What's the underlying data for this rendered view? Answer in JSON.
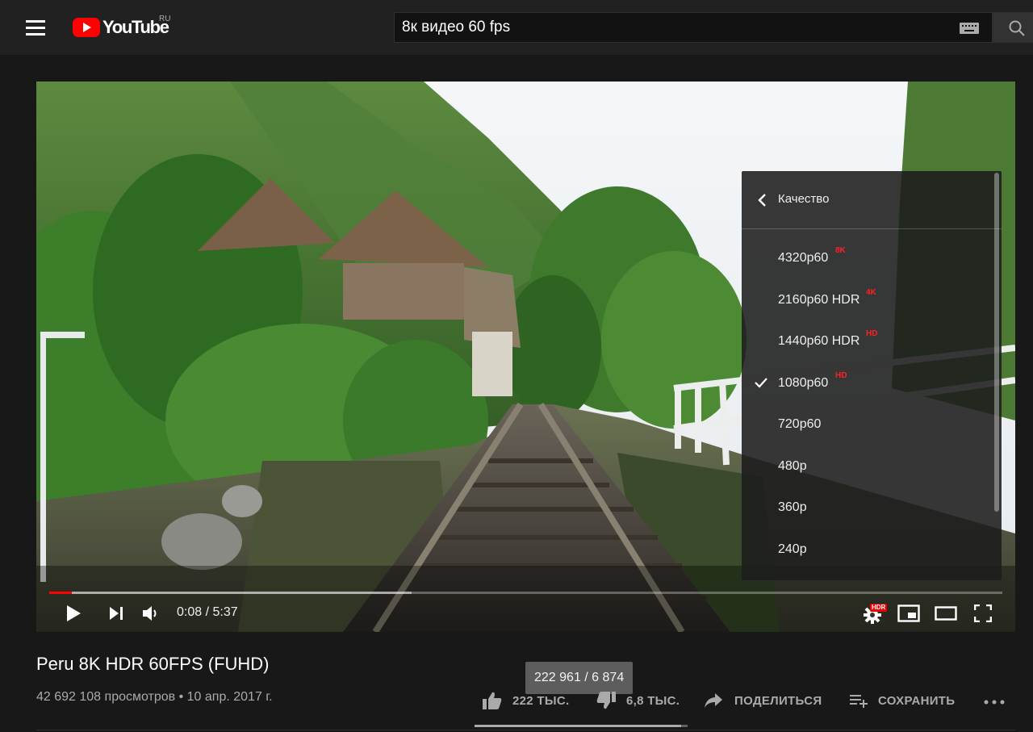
{
  "header": {
    "logo_text": "YouTube",
    "country_code": "RU",
    "search_query": "8к видео 60 fps"
  },
  "player": {
    "current_time": "0:08",
    "duration": "5:37",
    "time_display": "0:08 / 5:37",
    "progress_fraction": 0.024,
    "buffer_fraction": 0.38,
    "hdr_badge": "HDR",
    "quality_menu": {
      "title": "Качество",
      "options": [
        {
          "label": "4320p60",
          "badge": "8K",
          "selected": false
        },
        {
          "label": "2160p60 HDR",
          "badge": "4K",
          "selected": false
        },
        {
          "label": "1440p60 HDR",
          "badge": "HD",
          "selected": false
        },
        {
          "label": "1080p60",
          "badge": "HD",
          "selected": true
        },
        {
          "label": "720p60",
          "badge": "",
          "selected": false
        },
        {
          "label": "480p",
          "badge": "",
          "selected": false
        },
        {
          "label": "360p",
          "badge": "",
          "selected": false
        },
        {
          "label": "240p",
          "badge": "",
          "selected": false
        }
      ]
    }
  },
  "video": {
    "title": "Peru 8K HDR 60FPS (FUHD)",
    "meta": "42 692 108 просмотров • 10 апр. 2017 г.",
    "tooltip": "222 961 / 6 874",
    "like_ratio": 0.97,
    "actions": {
      "like": "222 ТЫС.",
      "dislike": "6,8 ТЫС.",
      "share": "ПОДЕЛИТЬСЯ",
      "save": "СОХРАНИТЬ"
    }
  },
  "colors": {
    "brand": "#ff0000",
    "background": "#181818",
    "header": "#212121",
    "quality_badge": "#ff2222"
  }
}
